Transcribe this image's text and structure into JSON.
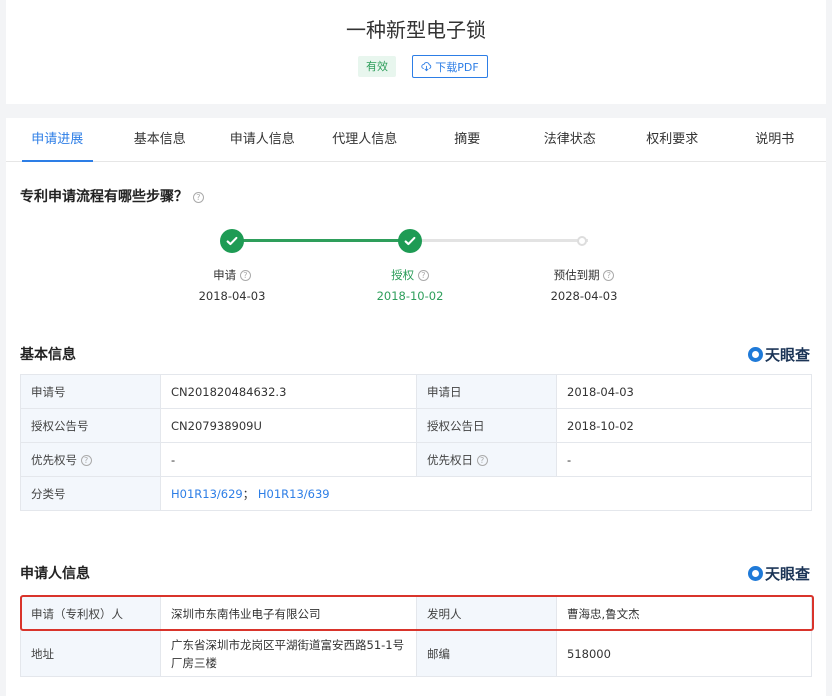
{
  "header": {
    "title": "一种新型电子锁",
    "status_badge": "有效",
    "download_label": "下载PDF"
  },
  "tabs": [
    "申请进展",
    "基本信息",
    "申请人信息",
    "代理人信息",
    "摘要",
    "法律状态",
    "权利要求",
    "说明书"
  ],
  "progress": {
    "title": "专利申请流程有哪些步骤？",
    "steps": [
      {
        "label": "申请",
        "date": "2018-04-03"
      },
      {
        "label": "授权",
        "date": "2018-10-02"
      },
      {
        "label": "预估到期",
        "date": "2028-04-03"
      }
    ]
  },
  "brand": "天眼查",
  "basic_info": {
    "title": "基本信息",
    "rows": [
      [
        "申请号",
        "CN201820484632.3",
        "申请日",
        "2018-04-03"
      ],
      [
        "授权公告号",
        "CN207938909U",
        "授权公告日",
        "2018-10-02"
      ],
      [
        "优先权号",
        "-",
        "优先权日",
        "-"
      ]
    ],
    "class_label": "分类号",
    "class_values": [
      "H01R13/629",
      "H01R13/639"
    ],
    "class_sep": "；"
  },
  "applicant_info": {
    "title": "申请人信息",
    "applicant_label": "申请（专利权）人",
    "applicant_value": "深圳市东南伟业电子有限公司",
    "inventor_label": "发明人",
    "inventor_value": "曹海忠,鲁文杰",
    "address_label": "地址",
    "address_value": "广东省深圳市龙岗区平湖街道富安西路51-1号厂房三楼",
    "postcode_label": "邮编",
    "postcode_value": "518000"
  },
  "colors": {
    "accent": "#2d7ee6",
    "success": "#2e9e5b",
    "highlight": "#d9342b"
  }
}
